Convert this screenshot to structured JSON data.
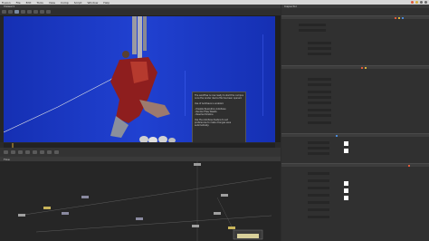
{
  "menubar": {
    "items": [
      "Fusion",
      "File",
      "Edit",
      "Tools",
      "View",
      "Comp",
      "Script",
      "Window",
      "Help"
    ]
  },
  "viewer": {
    "tab_label": "Viewer1"
  },
  "flow": {
    "tab_label": "Flow"
  },
  "inspector": {
    "title": "Inspector"
  },
  "dialog": {
    "lines": [
      "The workflow is now ready to start the composition",
      "once the render device file has been opened.",
      "",
      "Use of AutoSave is enabled.",
      "",
      "- Disable Resolution AutoSave",
      "- Render Files/ Resets",
      "- Resolve timeline",
      "",
      "Use the AutoSave feature to set",
      "preferences to make changes save",
      "automatically."
    ]
  },
  "colors": {
    "bluescreen": "#1b39c9",
    "accent": "#c05a32"
  }
}
